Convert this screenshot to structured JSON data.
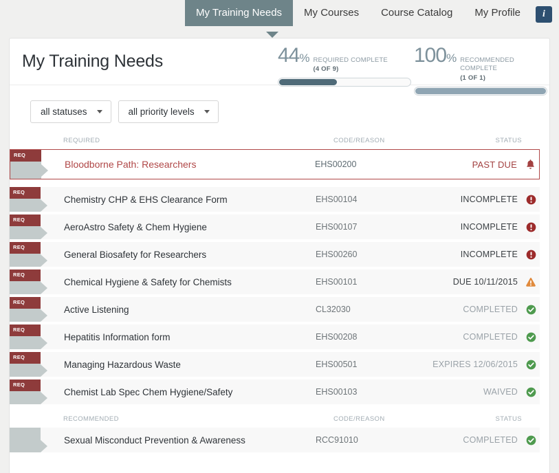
{
  "nav": {
    "tabs": [
      {
        "label": "My Training Needs",
        "active": true
      },
      {
        "label": "My Courses",
        "active": false
      },
      {
        "label": "Course Catalog",
        "active": false
      },
      {
        "label": "My Profile",
        "active": false
      }
    ],
    "info_icon": "info-icon",
    "info_glyph": "i"
  },
  "header": {
    "title": "My Training Needs"
  },
  "progress": {
    "required": {
      "percent": "44",
      "symbol": "%",
      "label": "REQUIRED COMPLETE",
      "sub": "(4 OF 9)",
      "fill_pct": 44,
      "color": "#4f6a78"
    },
    "recommended": {
      "percent": "100",
      "symbol": "%",
      "label": "RECOMMENDED COMPLETE",
      "sub": "(1 OF 1)",
      "fill_pct": 100,
      "color": "#8fa5b3"
    }
  },
  "filters": [
    {
      "label": "all statuses",
      "name": "status-filter"
    },
    {
      "label": "all priority levels",
      "name": "priority-filter"
    }
  ],
  "sections": [
    {
      "heading": "REQUIRED",
      "code_heading": "CODE/REASON",
      "status_heading": "STATUS",
      "ribbon_label": "REQ",
      "rows": [
        {
          "name": "Bloodborne Path: Researchers",
          "code": "EHS00200",
          "status": "PAST DUE",
          "icon": "bell-icon",
          "state": "pastdue"
        },
        {
          "name": "Chemistry CHP & EHS Clearance Form",
          "code": "EHS00104",
          "status": "INCOMPLETE",
          "icon": "exclamation-circle-icon",
          "state": "incomplete"
        },
        {
          "name": "AeroAstro Safety & Chem Hygiene",
          "code": "EHS00107",
          "status": "INCOMPLETE",
          "icon": "exclamation-circle-icon",
          "state": "incomplete"
        },
        {
          "name": "General Biosafety for Researchers",
          "code": "EHS00260",
          "status": "INCOMPLETE",
          "icon": "exclamation-circle-icon",
          "state": "incomplete"
        },
        {
          "name": "Chemical Hygiene & Safety for Chemists",
          "code": "EHS00101",
          "status": "DUE 10/11/2015",
          "icon": "warning-triangle-icon",
          "state": "due"
        },
        {
          "name": "Active Listening",
          "code": "CL32030",
          "status": "COMPLETED",
          "icon": "check-circle-icon",
          "state": "completed"
        },
        {
          "name": "Hepatitis Information form",
          "code": "EHS00208",
          "status": "COMPLETED",
          "icon": "check-circle-icon",
          "state": "completed"
        },
        {
          "name": "Managing Hazardous Waste",
          "code": "EHS00501",
          "status": "EXPIRES 12/06/2015",
          "icon": "check-circle-icon",
          "state": "completed"
        },
        {
          "name": "Chemist Lab Spec Chem Hygiene/Safety",
          "code": "EHS00103",
          "status": "WAIVED",
          "icon": "check-circle-icon",
          "state": "completed"
        }
      ]
    },
    {
      "heading": "RECOMMENDED",
      "code_heading": "CODE/REASON",
      "status_heading": "STATUS",
      "ribbon_label": "",
      "rows": [
        {
          "name": "Sexual Misconduct Prevention & Awareness",
          "code": "RCC91010",
          "status": "COMPLETED",
          "icon": "check-circle-icon",
          "state": "completed"
        }
      ]
    }
  ],
  "colors": {
    "accent_tab": "#6e8489",
    "required_red": "#8e3b3b",
    "past_due_red": "#b04747",
    "incomplete_red": "#9c2b2b",
    "due_orange": "#e08a3c",
    "complete_green": "#4e9a4e",
    "info_blue": "#2d4f70"
  }
}
